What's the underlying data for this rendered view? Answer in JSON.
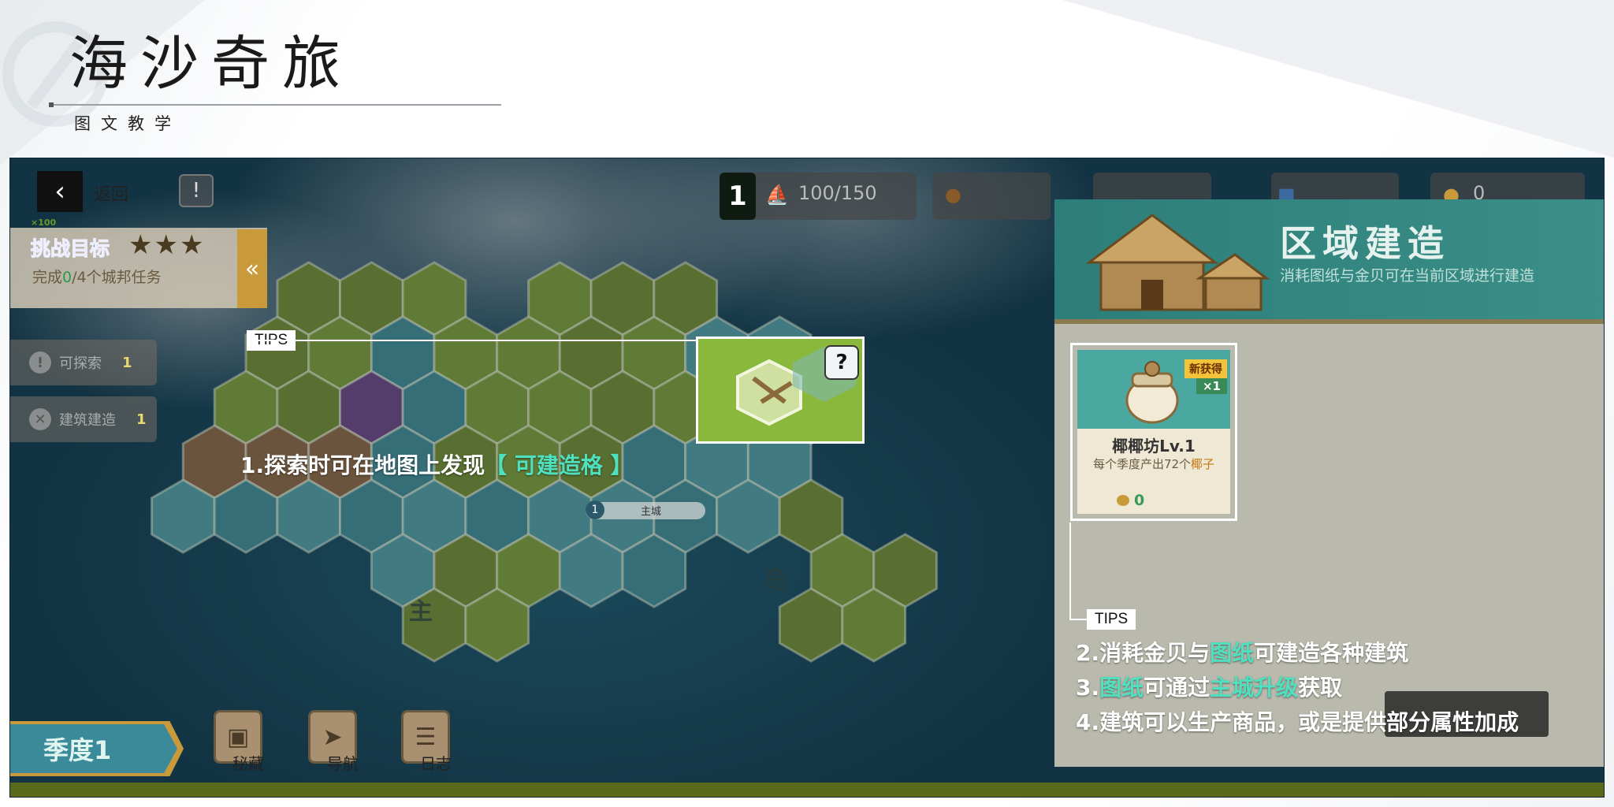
{
  "header": {
    "title": "海沙奇旅",
    "subtitle": "图文教学"
  },
  "game": {
    "back_label": "返回",
    "reward_text": "×100",
    "challenge": {
      "title": "挑战目标",
      "stars": "★★★",
      "desc_prefix": "完成",
      "desc_count": "0",
      "desc_suffix": "/4个城邦任务",
      "collapse_glyph": "«"
    },
    "side_items": [
      {
        "label": "可探索",
        "count": "1"
      },
      {
        "label": "建筑建造",
        "count": "1"
      }
    ],
    "resources": {
      "level": "1",
      "capacity": "100/150",
      "shell_count": "0"
    },
    "map_labels": {
      "main_city": "主城",
      "main_city_level": "1",
      "zone_a": "主",
      "zone_b": "岛"
    },
    "season": "季度1",
    "bottom_buttons": [
      {
        "label": "秘藏"
      },
      {
        "label": "导航"
      },
      {
        "label": "日志"
      }
    ]
  },
  "build_panel": {
    "title": "区域建造",
    "desc": "消耗图纸与金贝可在当前区域进行建造",
    "card": {
      "badge": "新获得",
      "qty": "×1",
      "name": "椰椰坊Lv.1",
      "prod_prefix": "每个季度产出72个",
      "prod_item": "椰子",
      "cost": "0"
    }
  },
  "tips": {
    "tag": "TIPS",
    "tip1": {
      "prefix": "1.探索时可在地图上发现",
      "highlight": "【 可建造格 】"
    },
    "tip2": {
      "prefix": "2.消耗金贝与",
      "hl": "图纸",
      "suffix": "可建造各种建筑"
    },
    "tip3": {
      "prefix": "3.",
      "hl1": "图纸",
      "mid": "可通过",
      "hl2": "主城升级",
      "suffix": "获取"
    },
    "tip4": {
      "text": "4.建筑可以生产商品，或是提供部分属性加成"
    }
  },
  "colors": {
    "highlight": "#4fe0c0",
    "panel_head": "#2d7e7a",
    "season": "#3a8a9a"
  }
}
